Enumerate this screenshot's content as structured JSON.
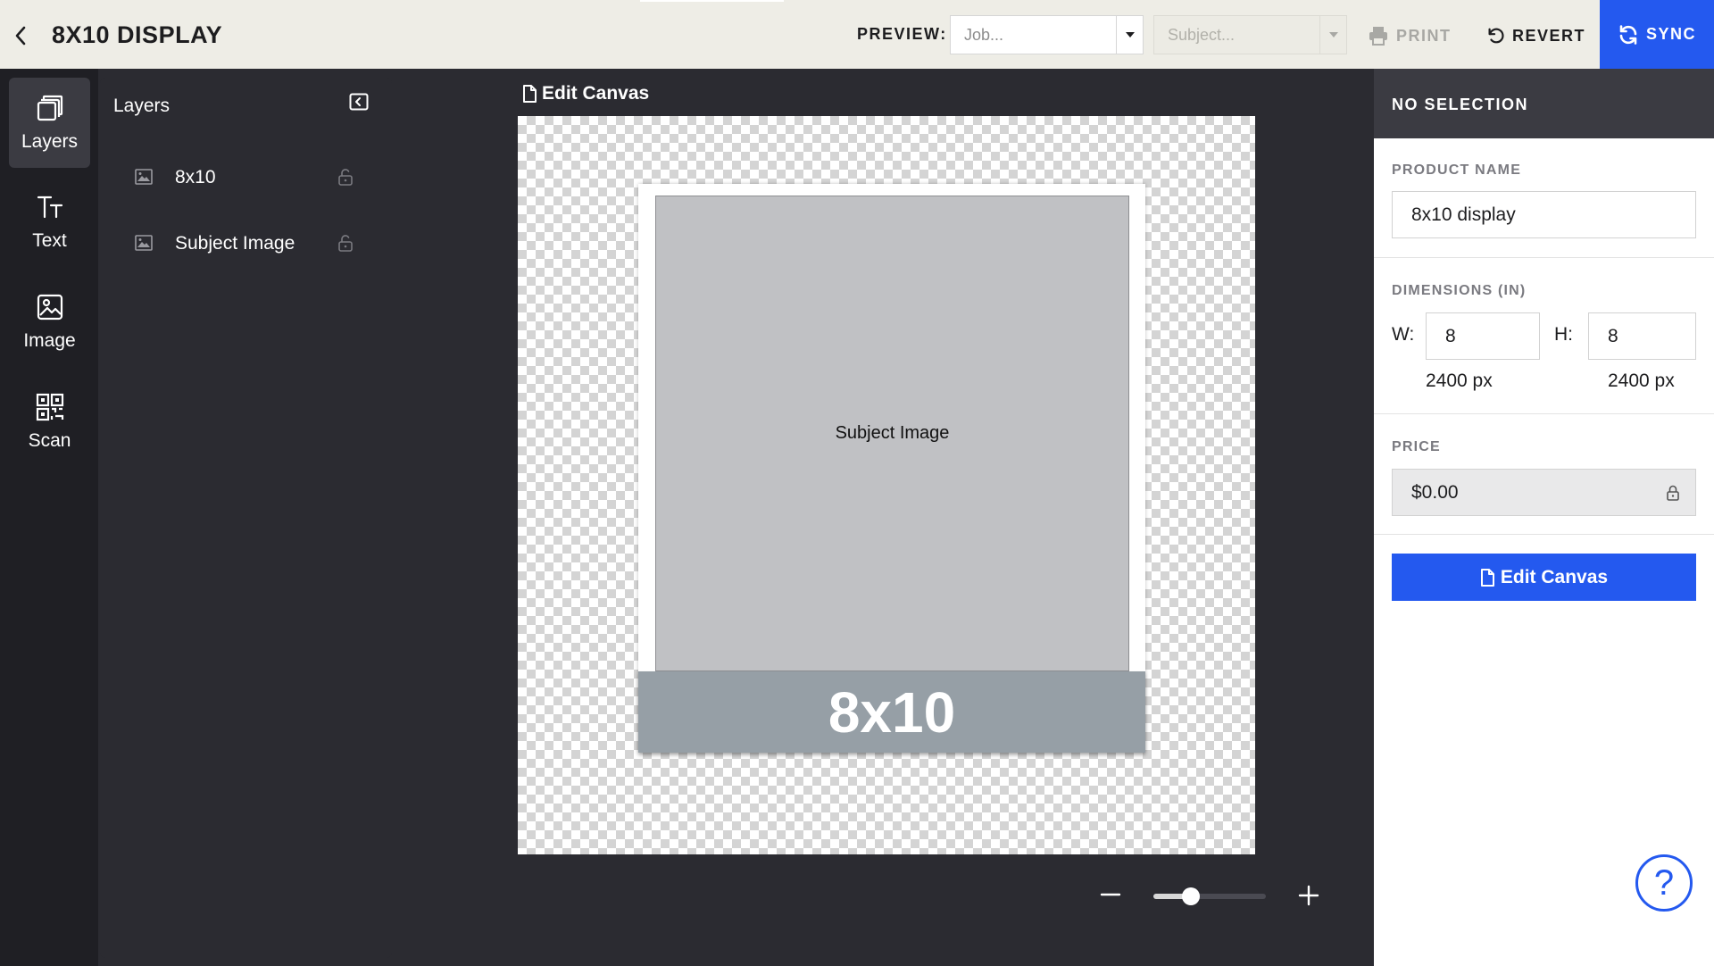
{
  "topbar": {
    "title": "8X10 DISPLAY",
    "preview_label": "PREVIEW:",
    "job_placeholder": "Job...",
    "subject_placeholder": "Subject...",
    "print_label": "PRINT",
    "revert_label": "REVERT",
    "sync_label": "SYNC"
  },
  "rail": {
    "items": [
      {
        "label": "Layers",
        "icon": "layers-icon",
        "active": true
      },
      {
        "label": "Text",
        "icon": "text-icon",
        "active": false
      },
      {
        "label": "Image",
        "icon": "image-icon",
        "active": false
      },
      {
        "label": "Scan",
        "icon": "qr-scan-icon",
        "active": false
      }
    ]
  },
  "layers_panel": {
    "title": "Layers",
    "layers": [
      {
        "label": "8x10",
        "icon": "image-icon",
        "locked": false
      },
      {
        "label": "Subject Image",
        "icon": "image-icon",
        "locked": false
      }
    ]
  },
  "canvas": {
    "header": "Edit Canvas",
    "subject_label": "Subject Image",
    "size_text": "8x10",
    "zoom_level": 0.33
  },
  "inspector": {
    "header": "NO SELECTION",
    "product_name_label": "PRODUCT NAME",
    "product_name_value": "8x10 display",
    "dimensions_label": "DIMENSIONS (IN)",
    "width_label": "W:",
    "width_value": "8",
    "height_label": "H:",
    "height_value": "8",
    "width_px": "2400 px",
    "height_px": "2400 px",
    "price_label": "PRICE",
    "price_value": "$0.00",
    "edit_canvas_label": "Edit Canvas",
    "help_symbol": "?"
  },
  "colors": {
    "accent": "#2459ef",
    "topbar_bg": "#eeede6",
    "rail_bg": "#1f1f24",
    "workspace_bg": "#2b2b31",
    "banner_bg": "#969fa6"
  }
}
